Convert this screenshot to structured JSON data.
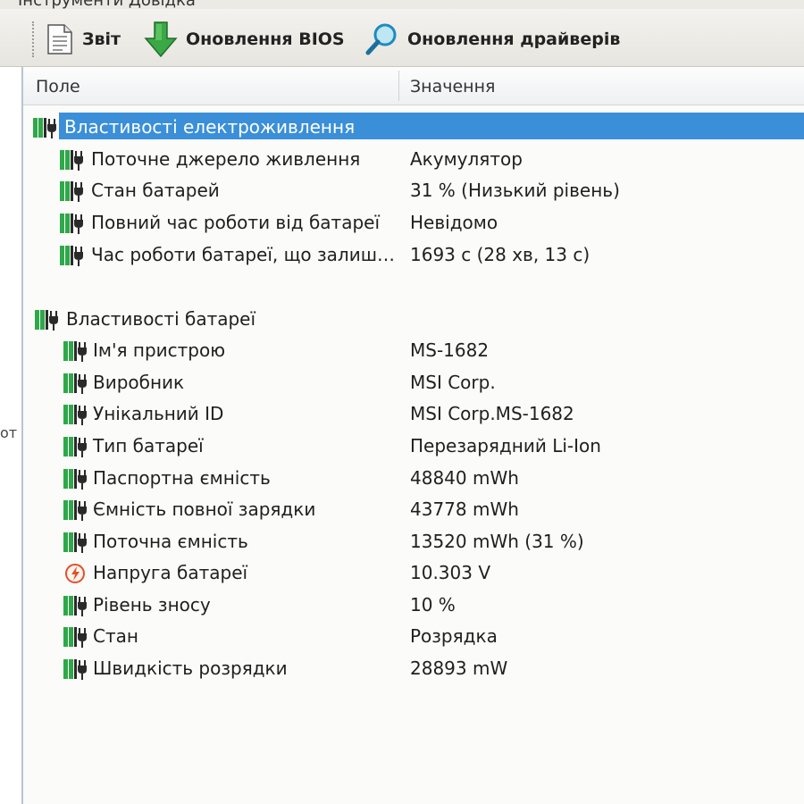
{
  "menubar": {
    "text": "Інструменти   Довідка"
  },
  "toolbar": {
    "report_label": "Звіт",
    "bios_update_label": "Оновлення BIOS",
    "driver_update_label": "Оновлення драйверів"
  },
  "left_pane": {
    "fragment": "от"
  },
  "columns": {
    "field": "Поле",
    "value": "Значення"
  },
  "groups": [
    {
      "title": "Властивості електроживлення",
      "selected": true,
      "items": [
        {
          "name": "Поточне джерело живлення",
          "value": "Акумулятор",
          "icon": "battery-plug-icon"
        },
        {
          "name": "Стан батарей",
          "value": "31 % (Низький рівень)",
          "icon": "battery-plug-icon"
        },
        {
          "name": "Повний час роботи від батареї",
          "value": "Невідомо",
          "icon": "battery-plug-icon"
        },
        {
          "name": "Час роботи батареї, що залиш…",
          "value": "1693 с (28 хв, 13 с)",
          "icon": "battery-plug-icon"
        }
      ]
    },
    {
      "title": "Властивості батареї",
      "selected": false,
      "items": [
        {
          "name": "Ім'я пристрою",
          "value": "MS-1682",
          "icon": "battery-plug-icon"
        },
        {
          "name": "Виробник",
          "value": "MSI Corp.",
          "icon": "battery-plug-icon"
        },
        {
          "name": "Унікальний ID",
          "value": "MSI Corp.MS-1682",
          "icon": "battery-plug-icon"
        },
        {
          "name": "Тип батареї",
          "value": "Перезарядний Li-Ion",
          "icon": "battery-plug-icon"
        },
        {
          "name": "Паспортна ємність",
          "value": "48840 mWh",
          "icon": "battery-plug-icon"
        },
        {
          "name": "Ємність повної зарядки",
          "value": "43778 mWh",
          "icon": "battery-plug-icon"
        },
        {
          "name": "Поточна ємність",
          "value": "13520 mWh  (31 %)",
          "icon": "battery-plug-icon"
        },
        {
          "name": "Напруга батареї",
          "value": "10.303 V",
          "icon": "voltage-icon"
        },
        {
          "name": "Рівень зносу",
          "value": "10 %",
          "icon": "battery-plug-icon"
        },
        {
          "name": "Стан",
          "value": "Розрядка",
          "icon": "battery-plug-icon"
        },
        {
          "name": "Швидкість розрядки",
          "value": "28893 mW",
          "icon": "battery-plug-icon"
        }
      ]
    }
  ],
  "colors": {
    "selection": "#3a8fd8",
    "battery_green": "#2fa84a",
    "battery_dark": "#2a2a2a",
    "voltage_ring": "#e0502a"
  }
}
